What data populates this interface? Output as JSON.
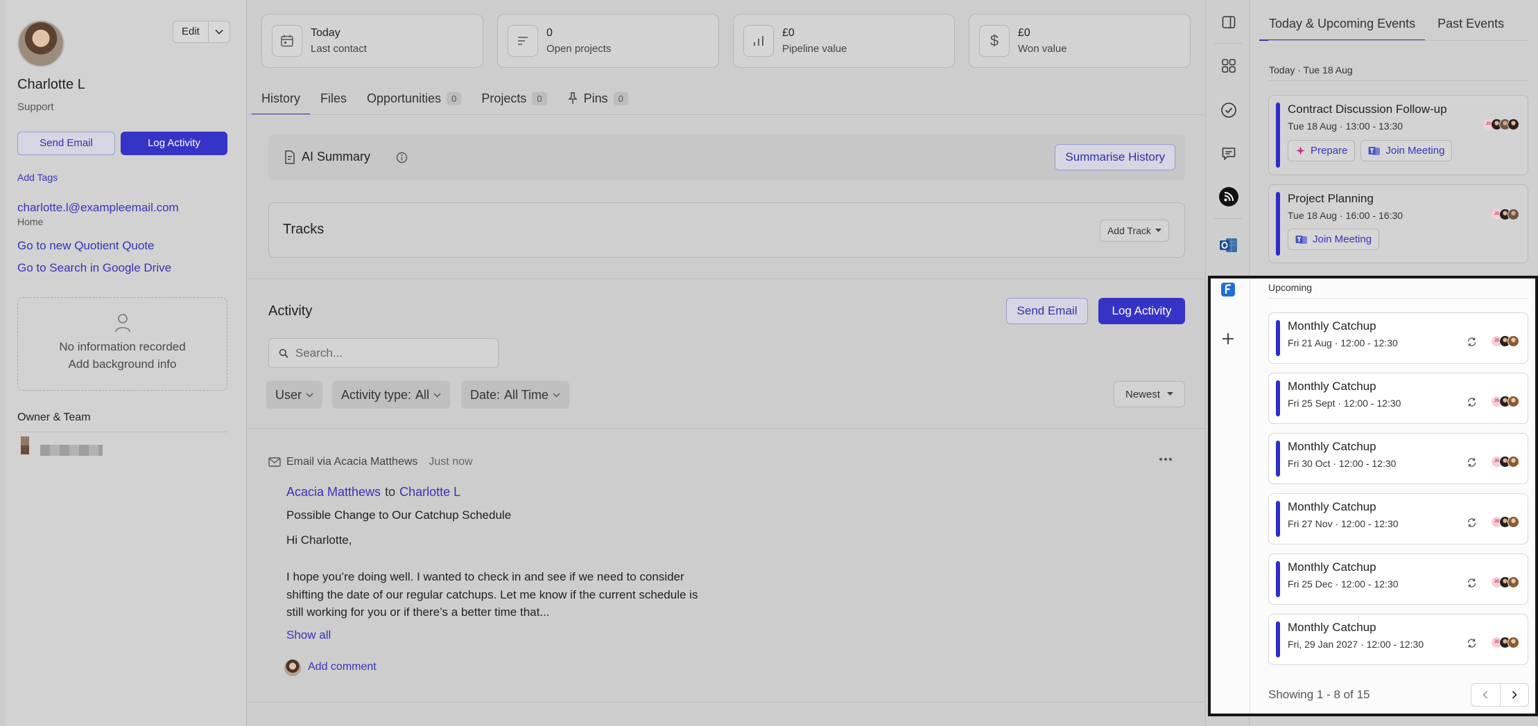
{
  "profile": {
    "name": "Charlotte L",
    "role": "Support",
    "edit_label": "Edit",
    "send_email_label": "Send Email",
    "log_activity_label": "Log Activity",
    "add_tags_label": "Add Tags",
    "email": "charlotte.l@exampleemail.com",
    "email_type": "Home",
    "link_quote": "Go to new Quotient Quote",
    "link_drive": "Go to Search in Google Drive",
    "no_info_line1": "No information recorded",
    "no_info_line2": "Add background info",
    "owner_team_label": "Owner & Team"
  },
  "stats": [
    {
      "value": "Today",
      "label": "Last contact",
      "icon": "calendar-icon"
    },
    {
      "value": "0",
      "label": "Open projects",
      "icon": "list-icon"
    },
    {
      "value": "£0",
      "label": "Pipeline value",
      "icon": "bar-chart-icon"
    },
    {
      "value": "£0",
      "label": "Won value",
      "icon": "dollar-icon"
    }
  ],
  "tabs": [
    {
      "label": "History",
      "active": true
    },
    {
      "label": "Files"
    },
    {
      "label": "Opportunities",
      "count": "0"
    },
    {
      "label": "Projects",
      "count": "0"
    },
    {
      "label": "Pins",
      "count": "0"
    }
  ],
  "ai_summary": {
    "title": "AI Summary",
    "button": "Summarise History"
  },
  "tracks": {
    "title": "Tracks",
    "add_label": "Add Track"
  },
  "activity": {
    "title": "Activity",
    "send_email_label": "Send Email",
    "log_activity_label": "Log Activity",
    "search_placeholder": "Search...",
    "filters": {
      "user": "User",
      "type_label": "Activity type:",
      "type_value": "All",
      "date_label": "Date:",
      "date_value": "All Time"
    },
    "sort": "Newest"
  },
  "email_item": {
    "source": "Email via Acacia Matthews",
    "time": "Just now",
    "from": "Acacia Matthews",
    "to_word": "to",
    "to": "Charlotte L",
    "subject": "Possible Change to Our Catchup Schedule",
    "greeting": "Hi Charlotte,",
    "body": "I hope you’re doing well. I wanted to check in and see if we need to consider shifting the date of our regular catchups. Let me know if the current schedule is still working for you or if there’s a better time that...",
    "show_all": "Show all",
    "add_comment": "Add comment"
  },
  "rail_icons": [
    "sidebar-toggle-icon",
    "apps-grid-icon",
    "check-circle-icon",
    "chat-icon",
    "rss-icon",
    "outlook-icon",
    "freeagent-icon",
    "plus-icon"
  ],
  "events_panel": {
    "tab_upcoming": "Today & Upcoming Events",
    "tab_past": "Past Events",
    "today_label": "Today · Tue 18 Aug",
    "today_events": [
      {
        "title": "Contract Discussion Follow-up",
        "time": "Tue 18 Aug · 13:00 - 13:30",
        "prepare_label": "Prepare",
        "join_label": "Join Meeting"
      },
      {
        "title": "Project Planning",
        "time": "Tue 18 Aug · 16:00 - 16:30",
        "join_label": "Join Meeting"
      }
    ],
    "upcoming_label": "Upcoming",
    "upcoming_events": [
      {
        "title": "Monthly Catchup",
        "time": "Fri 21 Aug · 12:00 - 12:30"
      },
      {
        "title": "Monthly Catchup",
        "time": "Fri 25 Sept · 12:00 - 12:30"
      },
      {
        "title": "Monthly Catchup",
        "time": "Fri 30 Oct · 12:00 - 12:30"
      },
      {
        "title": "Monthly Catchup",
        "time": "Fri 27 Nov · 12:00 - 12:30"
      },
      {
        "title": "Monthly Catchup",
        "time": "Fri 25 Dec · 12:00 - 12:30"
      },
      {
        "title": "Monthly Catchup",
        "time": "Fri, 29 Jan 2027 · 12:00 - 12:30"
      }
    ],
    "showing_text": "Showing 1 - 8 of 15",
    "attendee_initials": "JS"
  },
  "colors": {
    "accent": "#3634c7",
    "event_bar": "#2f2dc9",
    "link": "#3533b8"
  }
}
